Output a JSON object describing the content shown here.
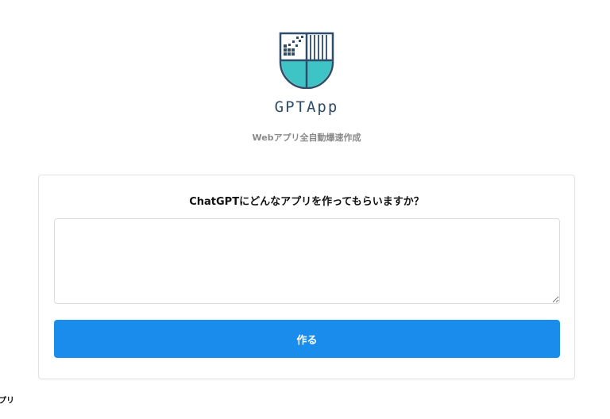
{
  "header": {
    "brand_name": "GPTApp",
    "tagline": "Webアプリ全自動爆速作成",
    "logo_icon": "shield-logo-icon"
  },
  "form": {
    "question": "ChatGPTにどんなアプリを作ってもらいますか？",
    "input_value": "",
    "submit_label": "作る"
  },
  "footer": {
    "text": "プリ"
  },
  "colors": {
    "accent": "#1a8cec",
    "logo_navy": "#2f4d6a",
    "logo_teal": "#3ec4c4"
  }
}
